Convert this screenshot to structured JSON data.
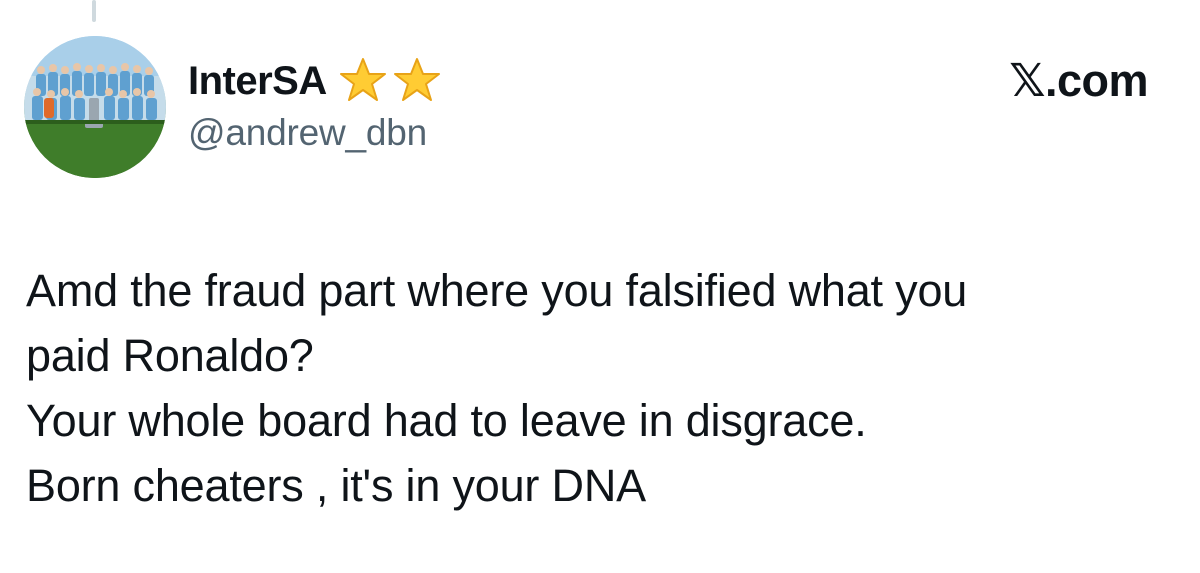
{
  "post": {
    "author": {
      "display_name": "InterSA",
      "handle": "@andrew_dbn",
      "badge_icons": [
        "star-icon",
        "star-icon"
      ]
    },
    "source_label": "𝕏.com",
    "lines": [
      "Amd the fraud part where you falsified what you",
      "paid Ronaldo?",
      "Your whole board had to leave in disgrace.",
      "Born cheaters , it's in your DNA"
    ]
  },
  "colors": {
    "text_primary": "#0f1419",
    "text_secondary": "#536471",
    "thread_line": "#cfd9de",
    "star_fill": "#ffcc33"
  }
}
